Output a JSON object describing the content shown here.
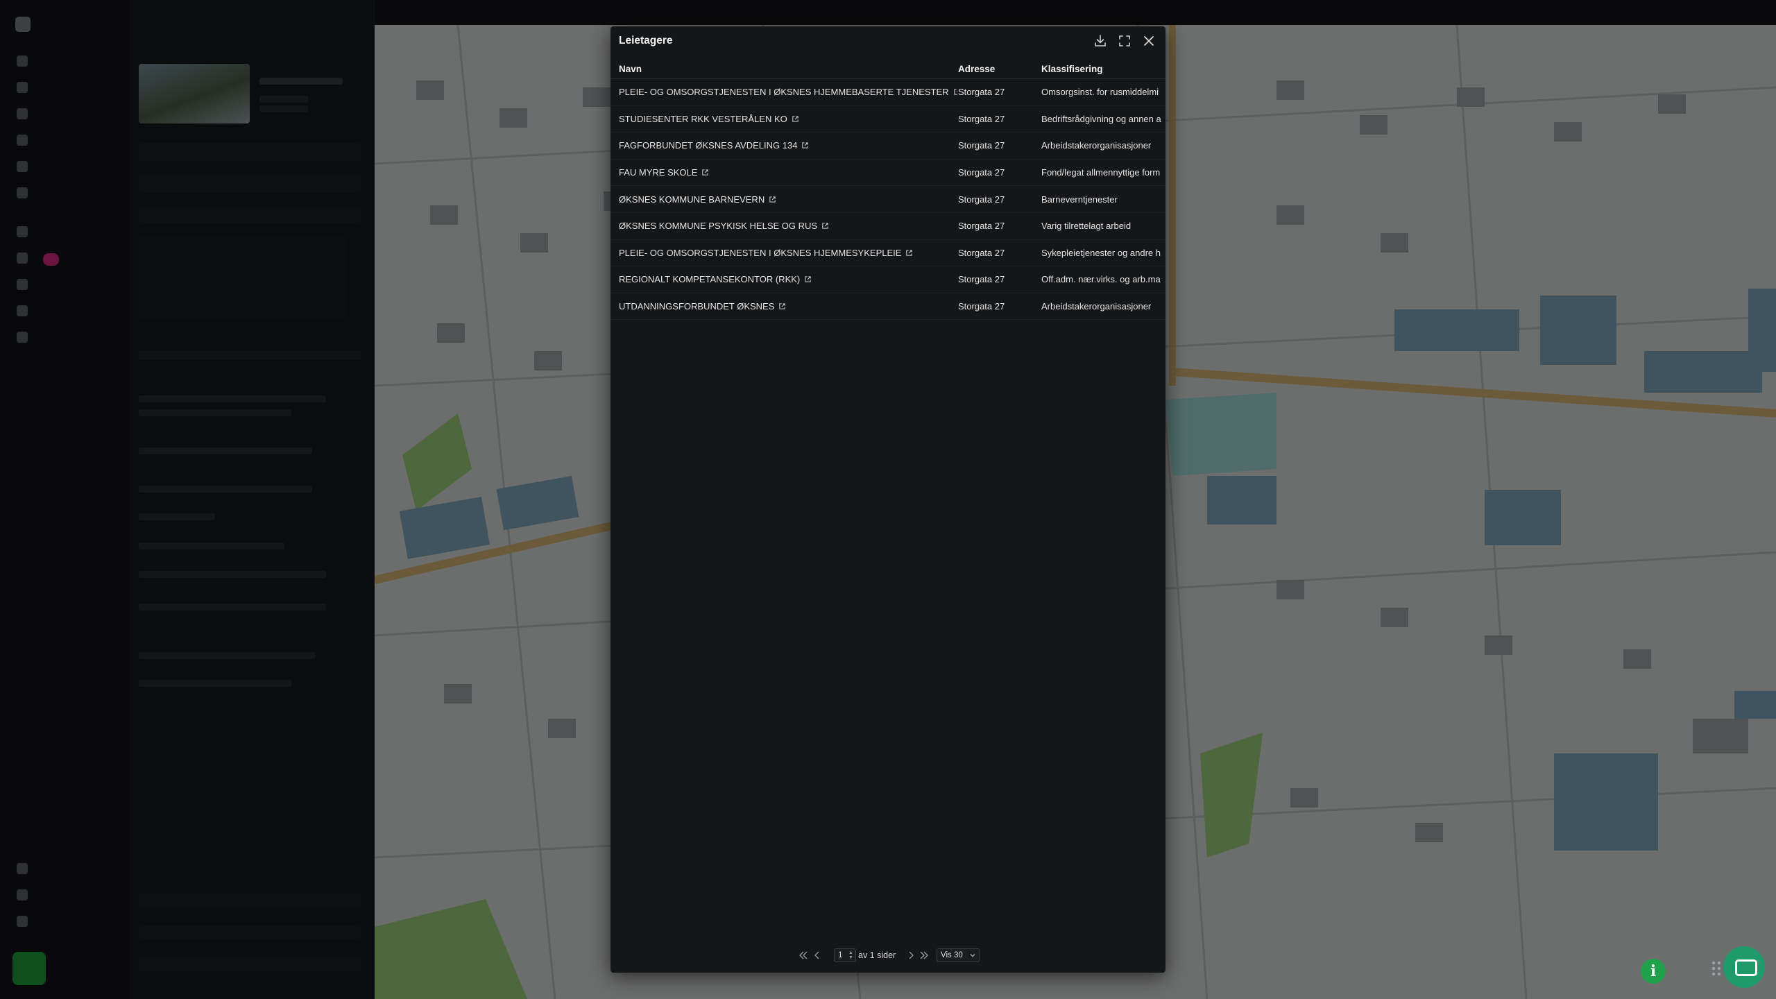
{
  "modal": {
    "title": "Leietagere",
    "columns": {
      "name": "Navn",
      "address": "Adresse",
      "classification": "Klassifisering"
    },
    "rows": [
      {
        "name": "PLEIE- OG OMSORGSTJENESTEN I ØKSNES HJEMMEBASERTE TJENESTER",
        "address": "Storgata 27",
        "classification": "Omsorgsinst. for rusmiddelmi"
      },
      {
        "name": "STUDIESENTER RKK VESTERÅLEN KO",
        "address": "Storgata 27",
        "classification": "Bedriftsrådgivning og annen a"
      },
      {
        "name": "FAGFORBUNDET ØKSNES AVDELING 134",
        "address": "Storgata 27",
        "classification": "Arbeidstakerorganisasjoner"
      },
      {
        "name": "FAU MYRE SKOLE",
        "address": "Storgata 27",
        "classification": "Fond/legat allmennyttige form"
      },
      {
        "name": "ØKSNES KOMMUNE BARNEVERN",
        "address": "Storgata 27",
        "classification": "Barneverntjenester"
      },
      {
        "name": "ØKSNES KOMMUNE PSYKISK HELSE OG RUS",
        "address": "Storgata 27",
        "classification": "Varig tilrettelagt arbeid"
      },
      {
        "name": "PLEIE- OG OMSORGSTJENESTEN I ØKSNES HJEMMESYKEPLEIE",
        "address": "Storgata 27",
        "classification": "Sykepleietjenester og andre h"
      },
      {
        "name": "REGIONALT KOMPETANSEKONTOR (RKK)",
        "address": "Storgata 27",
        "classification": "Off.adm. nær.virks. og arb.ma"
      },
      {
        "name": "UTDANNINGSFORBUNDET ØKSNES",
        "address": "Storgata 27",
        "classification": "Arbeidstakerorganisasjoner"
      }
    ],
    "pagination": {
      "current_page": "1",
      "of_text": "av 1 sider",
      "page_size_label": "Vis 30"
    }
  },
  "icons": {
    "download": "download-icon",
    "expand": "expand-icon",
    "close": "close-icon",
    "external": "external-link-icon",
    "info": "info-icon",
    "chat": "chat-icon"
  },
  "colors": {
    "modal_bg": "#151618",
    "accent_green": "#1fa04a",
    "map_bg": "#d8dadb",
    "building_blue": "#7fa9bd"
  }
}
